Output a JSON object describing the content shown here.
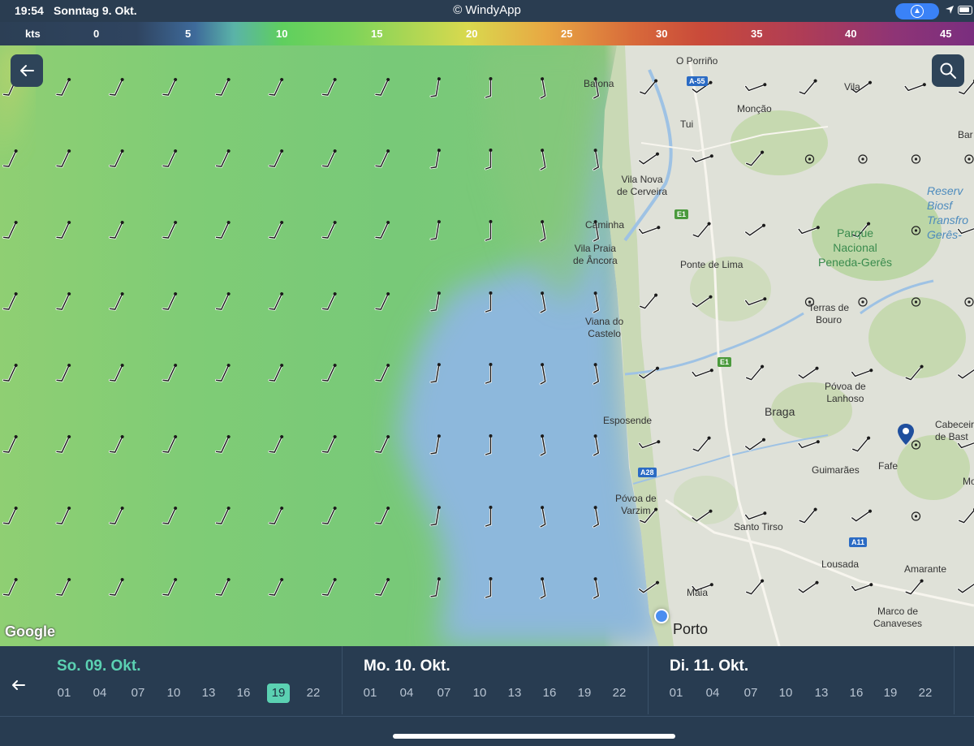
{
  "status_bar": {
    "time": "19:54",
    "date": "Sonntag 9. Okt.",
    "title": "© WindyApp"
  },
  "legend": {
    "unit": "kts",
    "ticks": [
      "0",
      "5",
      "10",
      "15",
      "20",
      "25",
      "30",
      "35",
      "40",
      "45"
    ]
  },
  "map": {
    "google_label": "Google",
    "places": [
      {
        "id": "o-porrino",
        "text": "O Porriño"
      },
      {
        "id": "baiona",
        "text": "Baiona"
      },
      {
        "id": "vila",
        "text": "Vila"
      },
      {
        "id": "moncao",
        "text": "Monção"
      },
      {
        "id": "tui",
        "text": "Tui"
      },
      {
        "id": "bar",
        "text": "Bar"
      },
      {
        "id": "vila-nova",
        "text": "Vila Nova\nde Cerveira"
      },
      {
        "id": "caminha",
        "text": "Caminha"
      },
      {
        "id": "vila-praia",
        "text": "Vila Praia\nde Âncora"
      },
      {
        "id": "ponte-lima",
        "text": "Ponte de Lima"
      },
      {
        "id": "terras-bouro",
        "text": "Terras de\nBouro"
      },
      {
        "id": "viana",
        "text": "Viana do\nCastelo"
      },
      {
        "id": "povoa-lanhoso",
        "text": "Póvoa de\nLanhoso"
      },
      {
        "id": "esposende",
        "text": "Esposende"
      },
      {
        "id": "braga",
        "text": "Braga"
      },
      {
        "id": "cabeceiras",
        "text": "Cabeceir\nde Bast"
      },
      {
        "id": "guimaraes",
        "text": "Guimarães"
      },
      {
        "id": "fafe",
        "text": "Fafe"
      },
      {
        "id": "povoa-varzim",
        "text": "Póvoa de\nVarzim"
      },
      {
        "id": "santo-tirso",
        "text": "Santo Tirso"
      },
      {
        "id": "lousada",
        "text": "Lousada"
      },
      {
        "id": "amarante",
        "text": "Amarante"
      },
      {
        "id": "maia",
        "text": "Maia"
      },
      {
        "id": "marco",
        "text": "Marco de\nCanaveses"
      },
      {
        "id": "porto",
        "text": "Porto"
      },
      {
        "id": "mo",
        "text": "Mo"
      }
    ],
    "park_label": "Parque\nNacional\nPeneda-Gerês",
    "reserve_label": "Reserv\nBiosf\nTransfro\nGerês-",
    "road_shields": [
      {
        "id": "a55",
        "text": "A-55"
      },
      {
        "id": "e1-top",
        "text": "E1"
      },
      {
        "id": "e1-mid",
        "text": "E1"
      },
      {
        "id": "a28",
        "text": "A28"
      },
      {
        "id": "a11",
        "text": "A11"
      }
    ],
    "back_icon": "arrow-left-icon",
    "search_icon": "search-icon"
  },
  "timeline": {
    "back_icon": "arrow-left-icon",
    "days": [
      {
        "title": "So. 09. Okt.",
        "active": true,
        "hours": [
          "01",
          "04",
          "07",
          "10",
          "13",
          "16",
          "19",
          "22"
        ],
        "selected": "19"
      },
      {
        "title": "Mo. 10. Okt.",
        "active": false,
        "hours": [
          "01",
          "04",
          "07",
          "10",
          "13",
          "16",
          "19",
          "22"
        ],
        "selected": ""
      },
      {
        "title": "Di. 11. Okt.",
        "active": false,
        "hours": [
          "01",
          "04",
          "07",
          "10",
          "13",
          "16",
          "19",
          "22"
        ],
        "selected": ""
      }
    ]
  },
  "colors": {
    "accent": "#5bd1b2",
    "panel": "#283c51",
    "sea_blue": "#8fb8dc",
    "wind_green": "#7fcc76"
  }
}
